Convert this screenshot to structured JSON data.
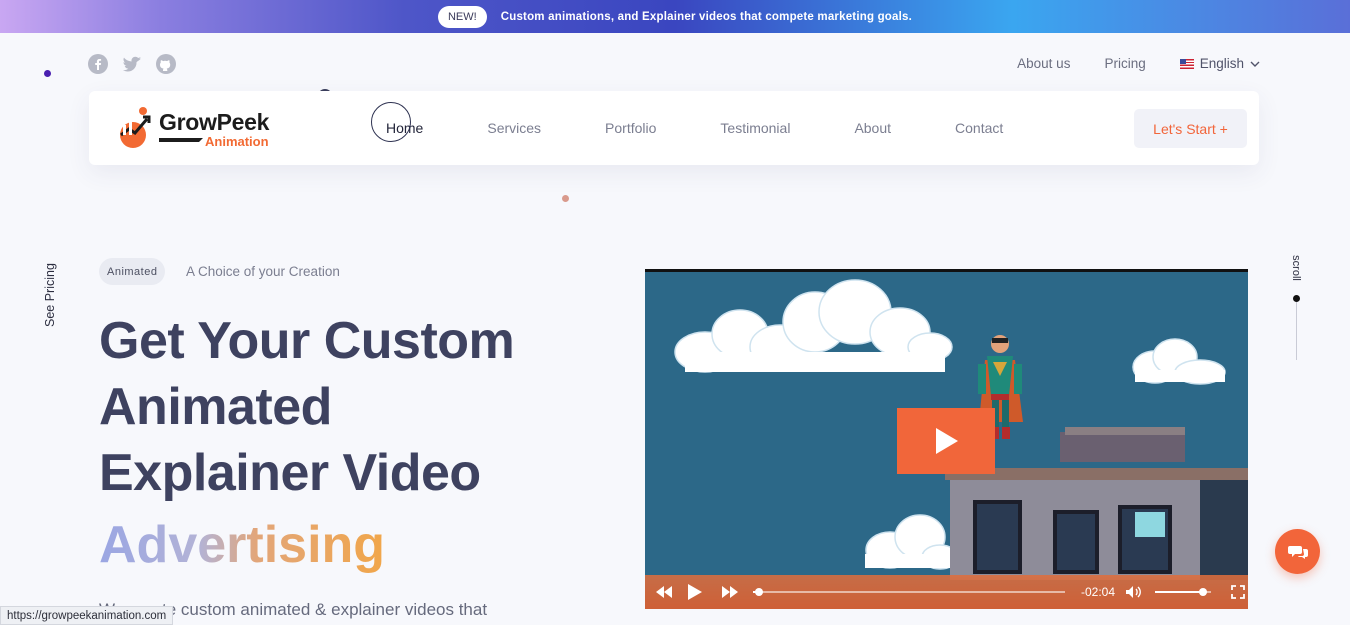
{
  "banner": {
    "badge": "NEW!",
    "text": "Custom animations, and Explainer videos that compete marketing goals."
  },
  "social": {
    "icons": [
      "facebook-icon",
      "twitter-icon",
      "github-icon"
    ]
  },
  "toplinks": {
    "about": "About us",
    "pricing": "Pricing",
    "language": "English"
  },
  "brand": {
    "name": "GrowPeek",
    "sub": "Animation"
  },
  "nav": {
    "items": [
      "Home",
      "Services",
      "Portfolio",
      "Testimonial",
      "About",
      "Contact"
    ],
    "active": "Home",
    "cta": "Let's Start +"
  },
  "side": {
    "see_pricing": "See Pricing",
    "scroll": "scroll"
  },
  "hero": {
    "tag": "Animated",
    "tag_side": "A Choice of your Creation",
    "title_lines": [
      "Get Your Custom",
      "Animated",
      "Explainer Video"
    ],
    "title_highlight": "Advertising",
    "description": "We create custom animated & explainer videos that"
  },
  "video": {
    "time": "-02:04",
    "progress": 0.02,
    "volume": 0.85
  },
  "status_url": "https://growpeekanimation.com",
  "colors": {
    "accent": "#f2653a",
    "heading": "#3e4260"
  }
}
